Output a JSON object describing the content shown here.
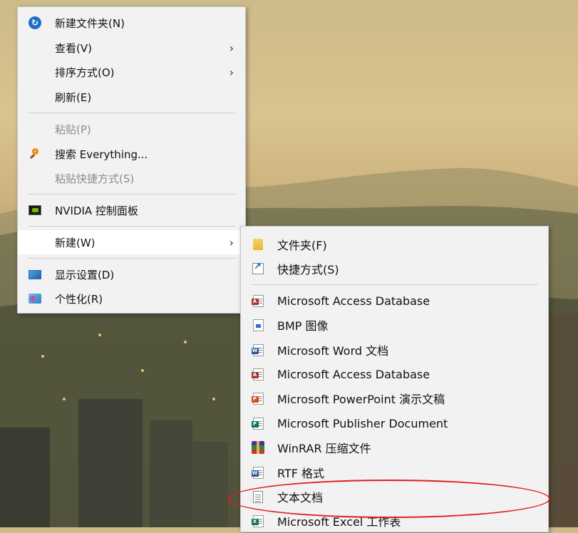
{
  "main_menu": {
    "items": [
      {
        "label": "新建文件夹(N)",
        "icon": "new-folder-icon",
        "disabled": false,
        "submenu": false
      },
      {
        "label": "查看(V)",
        "icon": null,
        "disabled": false,
        "submenu": true
      },
      {
        "label": "排序方式(O)",
        "icon": null,
        "disabled": false,
        "submenu": true
      },
      {
        "label": "刷新(E)",
        "icon": null,
        "disabled": false,
        "submenu": false
      },
      {
        "label": "粘贴(P)",
        "icon": null,
        "disabled": true,
        "submenu": false
      },
      {
        "label": "搜索 Everything...",
        "icon": "search-icon",
        "disabled": false,
        "submenu": false
      },
      {
        "label": "粘贴快捷方式(S)",
        "icon": null,
        "disabled": true,
        "submenu": false
      },
      {
        "label": "NVIDIA 控制面板",
        "icon": "nvidia-icon",
        "disabled": false,
        "submenu": false
      },
      {
        "label": "新建(W)",
        "icon": null,
        "disabled": false,
        "submenu": true,
        "highlighted": true
      },
      {
        "label": "显示设置(D)",
        "icon": "display-icon",
        "disabled": false,
        "submenu": false
      },
      {
        "label": "个性化(R)",
        "icon": "personalize-icon",
        "disabled": false,
        "submenu": false
      }
    ]
  },
  "new_submenu": {
    "items": [
      {
        "label": "文件夹(F)",
        "icon": "folder-icon"
      },
      {
        "label": "快捷方式(S)",
        "icon": "shortcut-icon"
      },
      {
        "label": "Microsoft Access Database",
        "icon": "access-icon"
      },
      {
        "label": "BMP 图像",
        "icon": "bmp-icon"
      },
      {
        "label": "Microsoft Word 文档",
        "icon": "word-icon"
      },
      {
        "label": "Microsoft Access Database",
        "icon": "access-icon"
      },
      {
        "label": "Microsoft PowerPoint 演示文稿",
        "icon": "powerpoint-icon"
      },
      {
        "label": "Microsoft Publisher Document",
        "icon": "publisher-icon"
      },
      {
        "label": "WinRAR 压缩文件",
        "icon": "winrar-icon"
      },
      {
        "label": "RTF 格式",
        "icon": "rtf-icon"
      },
      {
        "label": "文本文档",
        "icon": "text-document-icon",
        "annotated": true
      },
      {
        "label": "Microsoft Excel 工作表",
        "icon": "excel-icon"
      }
    ]
  },
  "colors": {
    "menu_bg": "#f2f2f2",
    "highlight_bg": "#ffffff",
    "disabled_text": "#8c8c8c",
    "annotation_red": "#e02020",
    "access_red": "#a4373a",
    "word_blue": "#2b579a",
    "powerpoint_orange": "#d24726",
    "publisher_teal": "#077568",
    "excel_green": "#217346"
  }
}
